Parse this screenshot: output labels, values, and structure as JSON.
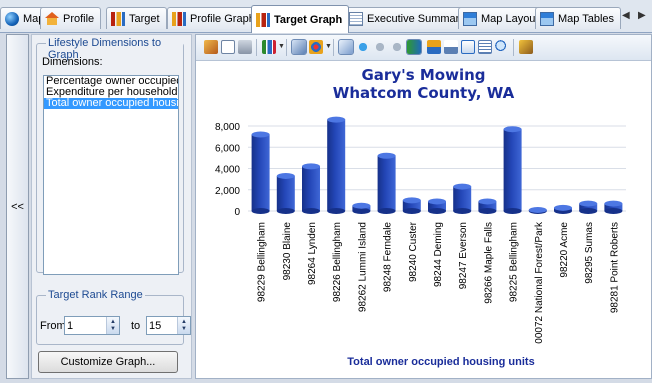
{
  "tabs": [
    {
      "label": "Map",
      "icon": "globe-icon"
    },
    {
      "label": "Profile",
      "icon": "house-icon"
    },
    {
      "label": "Target",
      "icon": "target-chart-icon"
    },
    {
      "label": "Profile Graph",
      "icon": "bar-chart-icon"
    },
    {
      "label": "Target Graph",
      "icon": "bar-chart-icon",
      "active": true
    },
    {
      "label": "Executive Summary",
      "icon": "document-icon"
    },
    {
      "label": "Map Layout",
      "icon": "map-layout-icon"
    },
    {
      "label": "Map Tables",
      "icon": "map-table-icon"
    }
  ],
  "tab_scroll": {
    "left": "◀",
    "right": "▶"
  },
  "collapse_label": "<<",
  "lifestyle": {
    "legend": "Lifestyle Dimensions to Graph",
    "dimensions_label": "Dimensions:",
    "dimensions": [
      "Percentage owner occupied ho",
      "Expenditure per household on c",
      "Total owner occupied housing"
    ],
    "selected_index": 2
  },
  "rank": {
    "legend": "Target Rank Range",
    "from_label": "From",
    "from_value": "1",
    "to_label": "to",
    "to_value": "15"
  },
  "customize_button": "Customize Graph...",
  "toolbar_icons": [
    "export-icon",
    "copy-icon",
    "print-icon",
    "gallery-icon",
    "pointer-icon",
    "palette-icon",
    "3d-icon",
    "rotate-icon",
    "perspective-icon",
    "axis-settings-icon",
    "legend-icon",
    "series-legend-icon",
    "data-labels-icon",
    "grid-icon",
    "data-table-icon",
    "zoom-icon",
    "properties-icon"
  ],
  "colors": {
    "bar": "#2447b8",
    "title": "#1a2d9a",
    "accent": "#3399ff"
  },
  "chart_data": {
    "type": "bar",
    "title": "Gary's Mowing",
    "subtitle": "Whatcom County, WA",
    "xlabel": "Total owner occupied housing units",
    "ylabel": "",
    "ylim": [
      0,
      8000
    ],
    "yticks": [
      "8,000",
      "6,000",
      "4,000",
      "2,000",
      "0"
    ],
    "ytick_values": [
      8000,
      6000,
      4000,
      2000,
      0
    ],
    "grid": true,
    "legend": "none",
    "categories": [
      "98229  Bellingham",
      "98230  Blaine",
      "98264  Lynden",
      "98226  Bellingham",
      "98262  Lummi Island",
      "98248  Ferndale",
      "98240  Custer",
      "98244  Deming",
      "98247  Everson",
      "98266  Maple Falls",
      "98225  Bellingham",
      "00072  National Forest/Park",
      "98220  Acme",
      "98295  Sumas",
      "98281  Point Roberts"
    ],
    "values": [
      7200,
      3300,
      4200,
      8600,
      500,
      5200,
      1000,
      900,
      2300,
      900,
      7700,
      100,
      300,
      700,
      700
    ]
  }
}
